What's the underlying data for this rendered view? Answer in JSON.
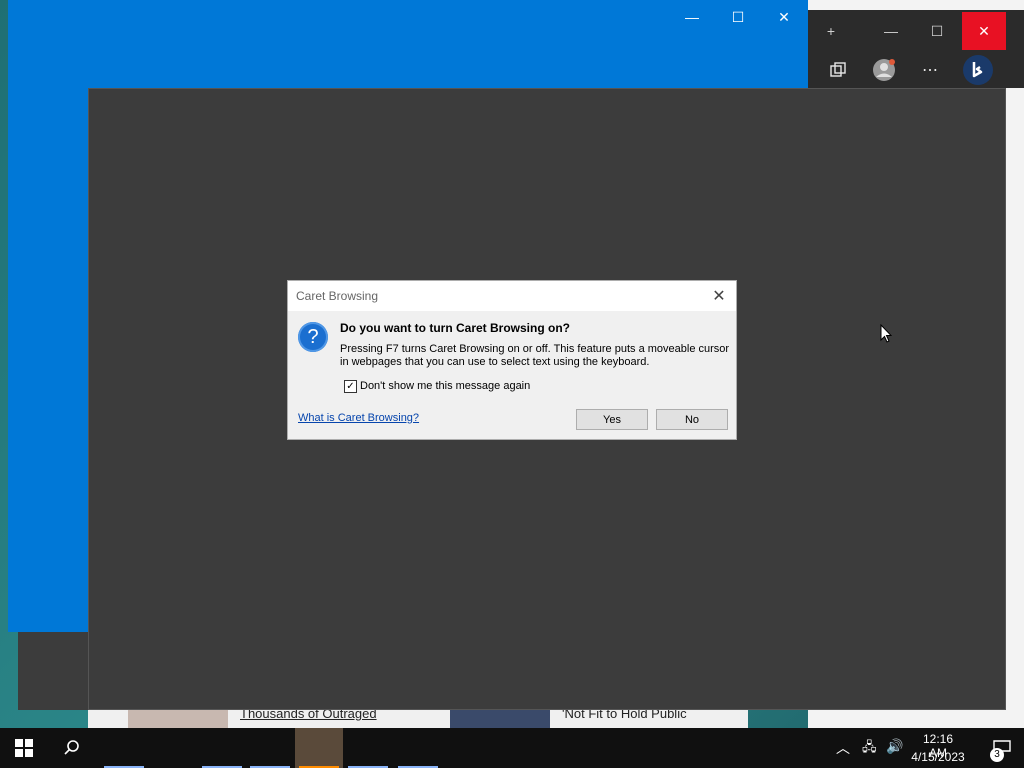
{
  "dialog": {
    "title": "Caret Browsing",
    "heading": "Do you want to turn Caret Browsing on?",
    "body": "Pressing F7 turns Caret Browsing on or off. This feature puts a moveable cursor in webpages that you can use to select text using the keyboard.",
    "checkbox_label": "Don't show me this message again",
    "checkbox_checked": true,
    "help_link": "What is Caret Browsing?",
    "yes_label": "Yes",
    "no_label": "No",
    "close_glyph": "✕",
    "icon_glyph": "?"
  },
  "blue_window": {
    "minimize_glyph": "—",
    "maximize_glyph": "☐",
    "close_glyph": "✕"
  },
  "edge": {
    "new_tab_glyph": "+",
    "minimize_glyph": "—",
    "maximize_glyph": "☐",
    "close_glyph": "✕",
    "collections_icon": "collections-icon",
    "profile_icon": "profile-icon",
    "more_glyph": "⋯",
    "bing_icon": "bing-icon",
    "headlines": [
      "Thousands of Outraged",
      "'Not Fit to Hold Public"
    ]
  },
  "taskbar": {
    "search_glyph": "⚲",
    "tray_chevron": "︿",
    "network_glyph": "🖧",
    "volume_glyph": "🔊",
    "time": "12:16 AM",
    "date": "4/15/2023",
    "notification_glyph": "🗨",
    "notification_count": "3"
  }
}
